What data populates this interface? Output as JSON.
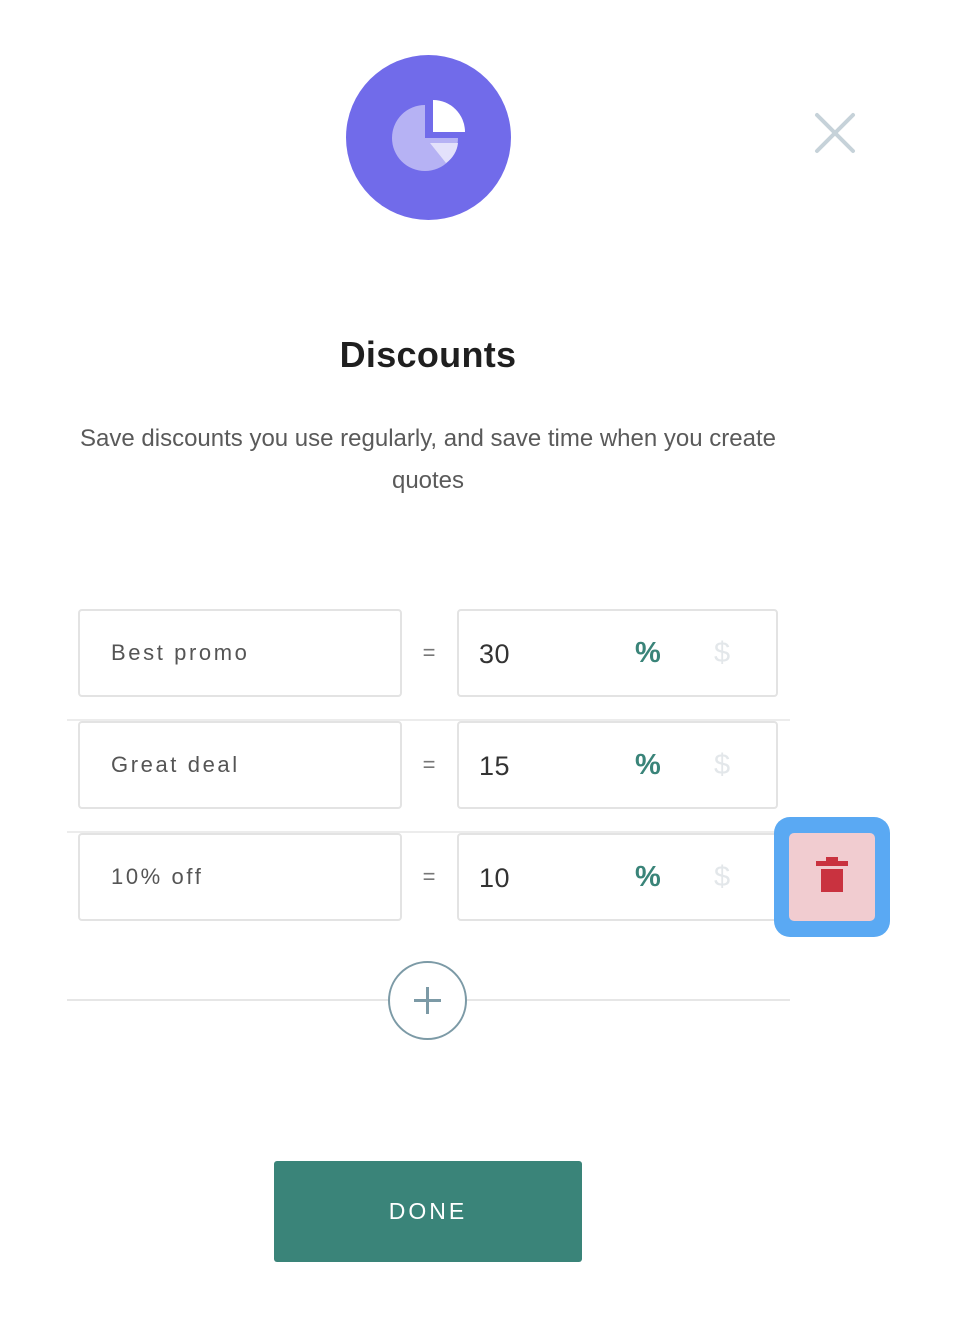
{
  "header": {
    "icon": "pie-chart-icon",
    "close_icon": "close-icon"
  },
  "title": "Discounts",
  "description": "Save discounts you use regularly, and save time when you create quotes",
  "discounts": [
    {
      "name": "Best promo",
      "equals": "=",
      "value": "30",
      "unit_percent": "%",
      "unit_dollar": "$",
      "selected_unit": "%"
    },
    {
      "name": "Great deal",
      "equals": "=",
      "value": "15",
      "unit_percent": "%",
      "unit_dollar": "$",
      "selected_unit": "%"
    },
    {
      "name": "10% off",
      "equals": "=",
      "value": "10",
      "unit_percent": "%",
      "unit_dollar": "$",
      "selected_unit": "%"
    }
  ],
  "delete_icon": "trash-icon",
  "add_icon": "plus-icon",
  "done_label": "DONE",
  "colors": {
    "brand_purple": "#716bea",
    "accent_green": "#3a8479",
    "delete_red": "#c9323f",
    "focus_blue": "#5aa9f3"
  }
}
